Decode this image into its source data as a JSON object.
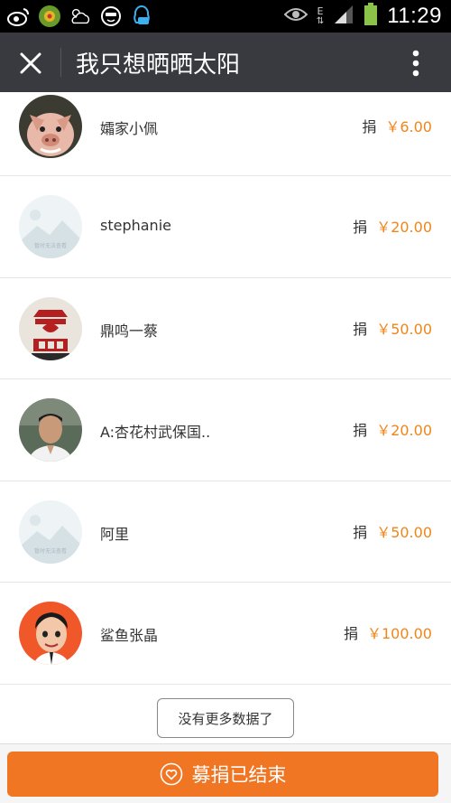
{
  "status_bar": {
    "time": "11:29",
    "network_label": "E",
    "icons": [
      "weibo-icon",
      "app-icon",
      "weather-icon",
      "emoji-icon",
      "qq-icon",
      "eye-icon",
      "signal-icon",
      "battery-icon"
    ]
  },
  "title_bar": {
    "title": "我只想晒晒太阳",
    "close_icon": "close-icon",
    "menu_icon": "more-vert-icon"
  },
  "donation_label": "捐",
  "donors": [
    {
      "name": "孀家小佩",
      "amount": "￥6.00",
      "avatar": "pig-avatar"
    },
    {
      "name": "stephanie",
      "amount": "￥20.00",
      "avatar": "placeholder-avatar"
    },
    {
      "name": "鼎鸣一蔡",
      "amount": "￥50.00",
      "avatar": "logo-avatar"
    },
    {
      "name": "A:杏花村武保国..",
      "amount": "￥20.00",
      "avatar": "man-avatar"
    },
    {
      "name": "阿里",
      "amount": "￥50.00",
      "avatar": "placeholder-avatar"
    },
    {
      "name": "鲨鱼张晶",
      "amount": "￥100.00",
      "avatar": "cartoon-avatar"
    }
  ],
  "placeholder_text": "暂时无法查看",
  "no_more_label": "没有更多数据了",
  "end_button_label": "募捐已结束",
  "colors": {
    "title_bar_bg": "#393a3f",
    "amount_color": "#f08519",
    "end_button_bg": "#f07624"
  }
}
